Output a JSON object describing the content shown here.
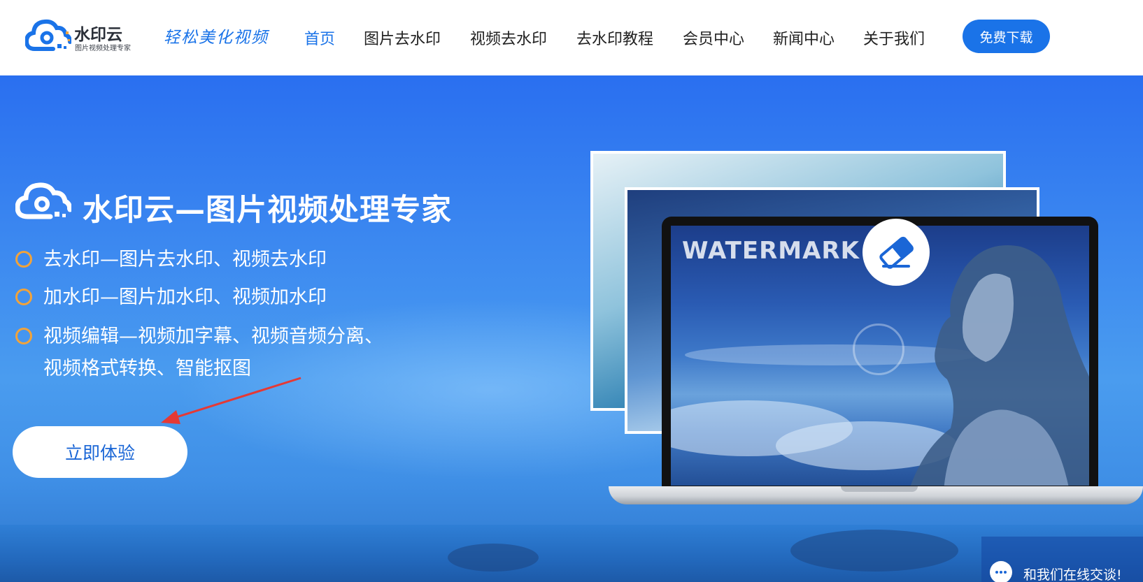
{
  "header": {
    "logo_name": "水印云",
    "logo_tagline": "图片视频处理专家",
    "slogan": "轻松美化视频",
    "nav": [
      {
        "label": "首页",
        "active": true
      },
      {
        "label": "图片去水印",
        "active": false
      },
      {
        "label": "视频去水印",
        "active": false
      },
      {
        "label": "去水印教程",
        "active": false
      },
      {
        "label": "会员中心",
        "active": false
      },
      {
        "label": "新闻中心",
        "active": false
      },
      {
        "label": "关于我们",
        "active": false
      }
    ],
    "download_label": "免费下载"
  },
  "hero": {
    "title": "水印云—图片视频处理专家",
    "features": [
      {
        "line1": "去水印—图片去水印、视频去水印"
      },
      {
        "line1": "加水印—图片加水印、视频加水印"
      },
      {
        "line1": "视频编辑—视频加字幕、视频音频分离、",
        "line2": "视频格式转换、智能抠图"
      }
    ],
    "cta_label": "立即体验",
    "screen_watermark": "WATERMARK"
  },
  "chat": {
    "label": "和我们在线交谈!"
  },
  "colors": {
    "brand_blue": "#1a73e8",
    "bullet_orange": "#f2a33a",
    "arrow_red": "#e53935"
  }
}
